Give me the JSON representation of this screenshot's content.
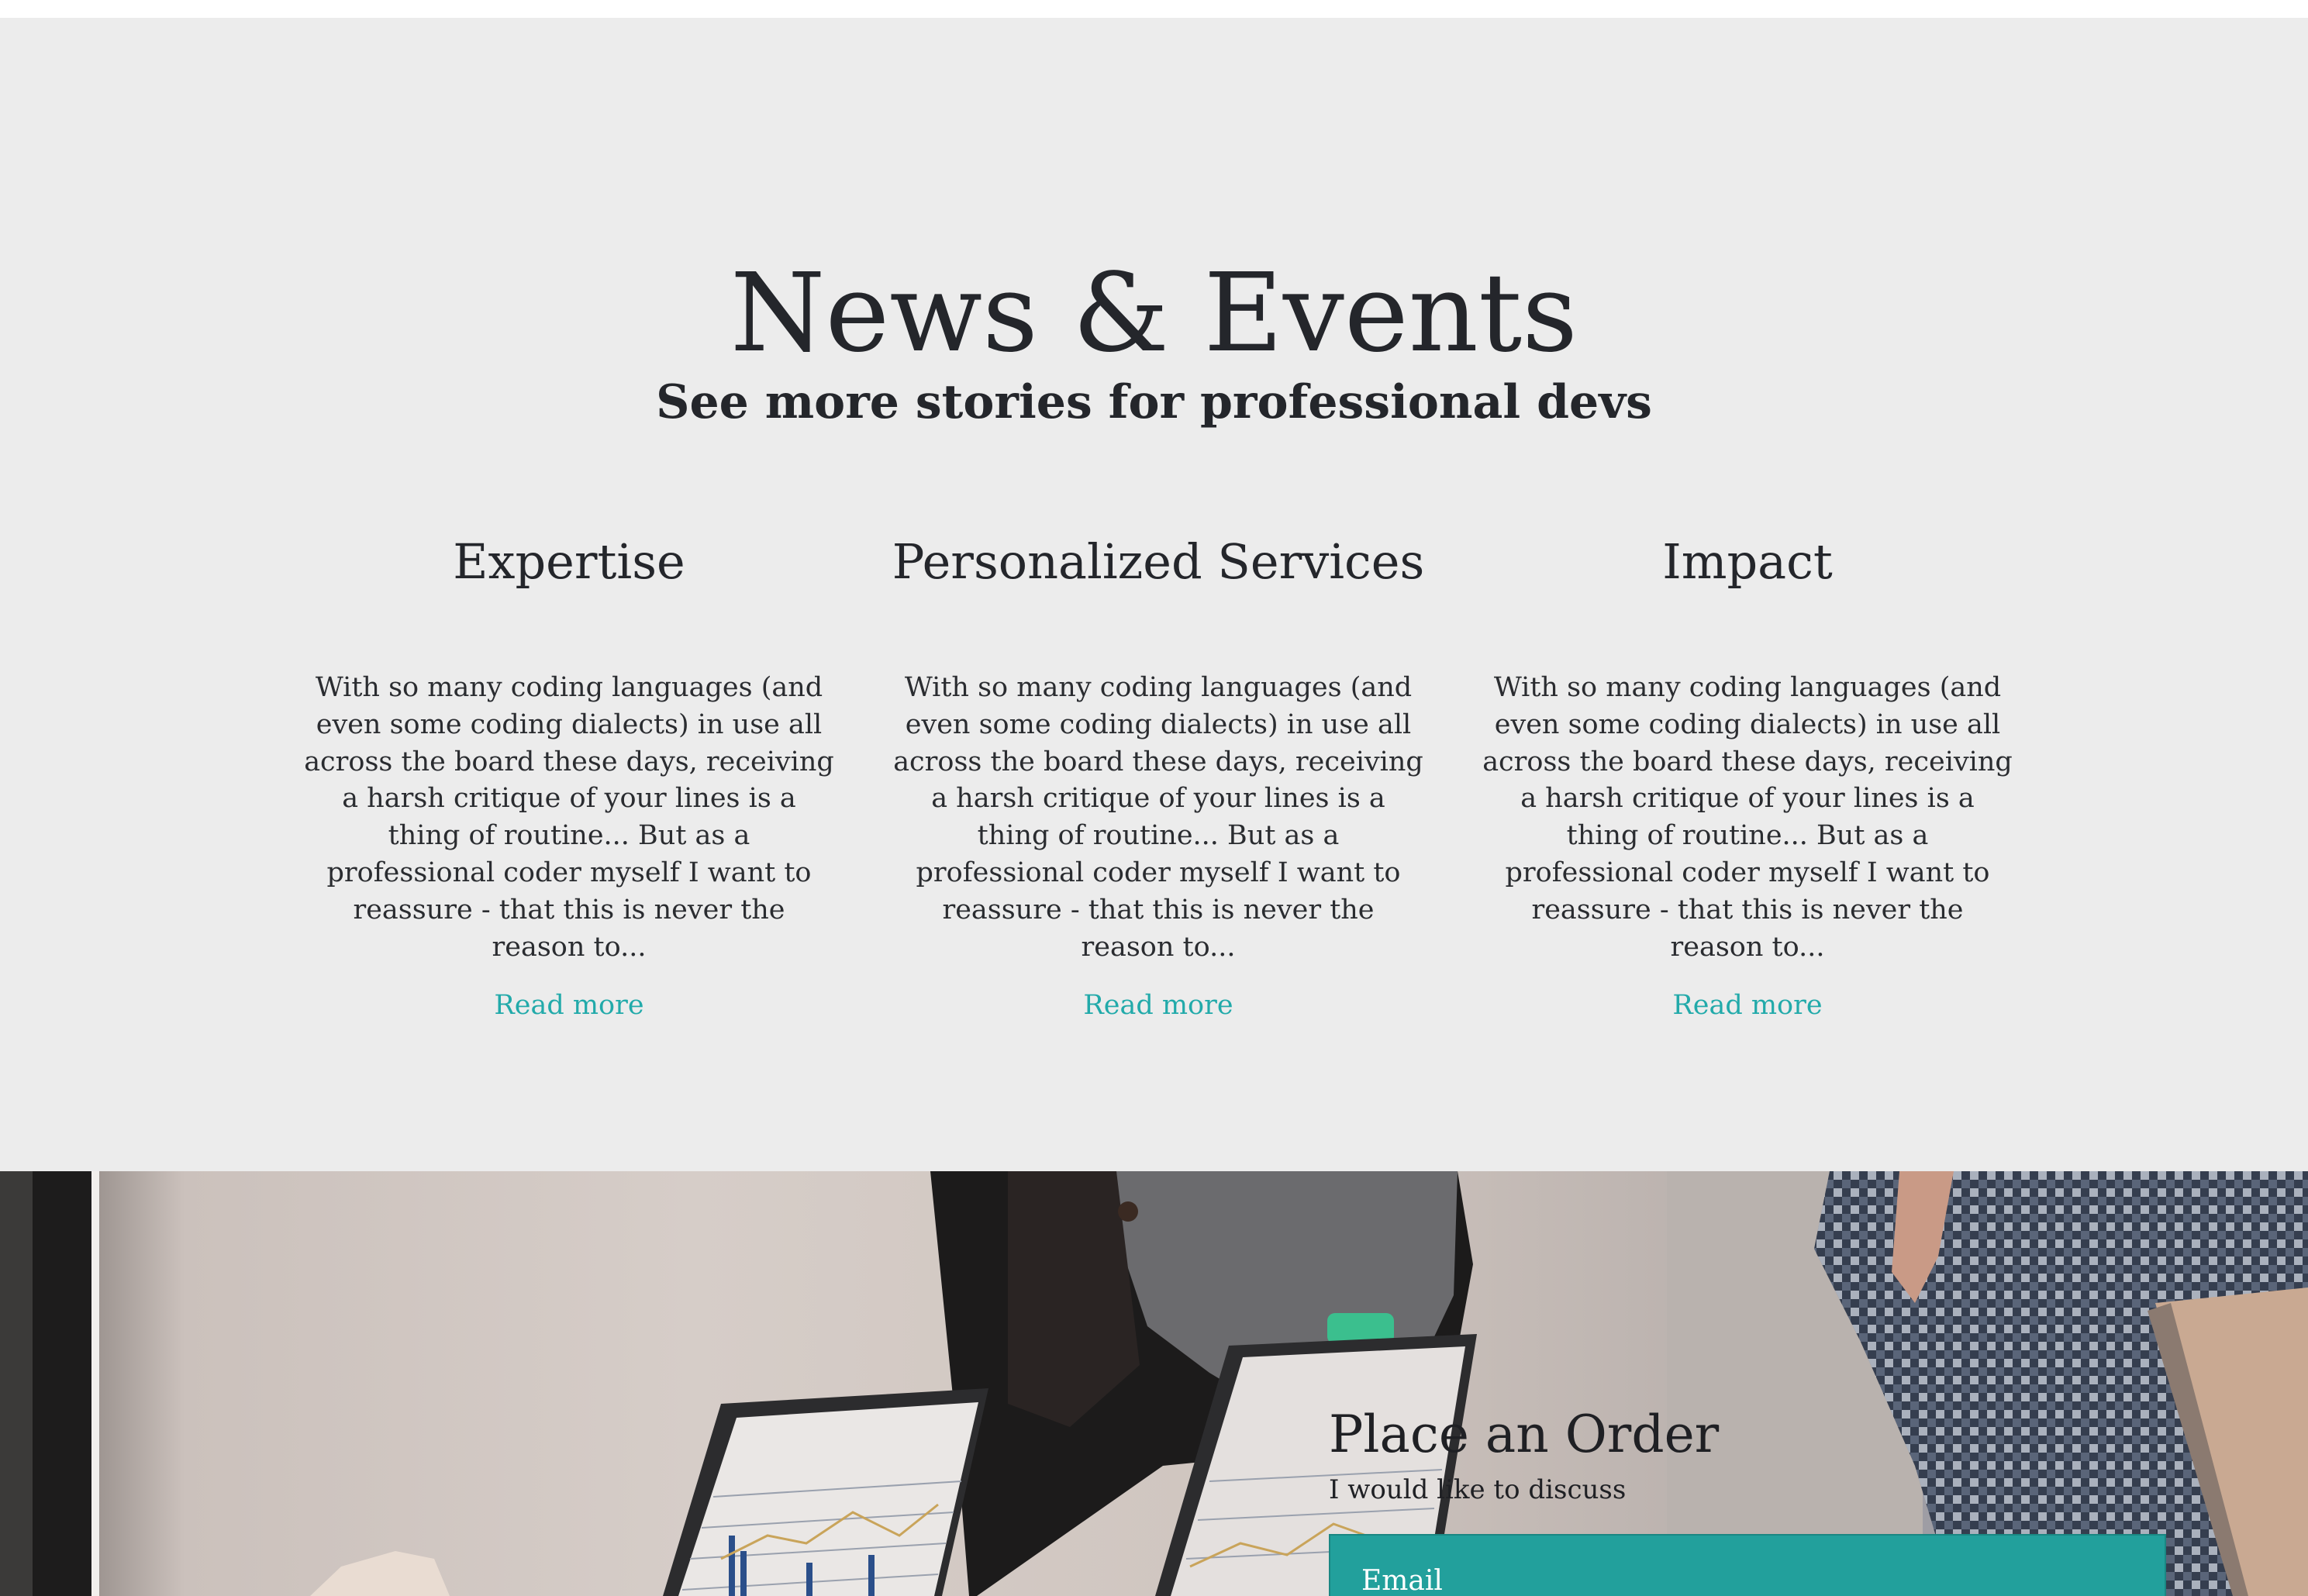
{
  "news": {
    "title": "News & Events",
    "subtitle": "See more stories for professional devs",
    "cards": [
      {
        "title": "Expertise",
        "body": "With so many coding languages (and even some coding dialects) in use all across the board these days, receiving a harsh critique of your lines is a thing of routine... But as a professional coder myself I want to reassure - that this is never the reason to...",
        "link": "Read more"
      },
      {
        "title": "Personalized Services",
        "body": "With so many coding languages (and even some coding dialects) in use all across the board these days, receiving a harsh critique of your lines is a thing of routine... But as a professional coder myself I want to reassure - that this is never the reason to...",
        "link": "Read more"
      },
      {
        "title": "Impact",
        "body": "With so many coding languages (and even some coding dialects) in use all across the board these days, receiving a harsh critique of your lines is a thing of routine... But as a professional coder myself I want to reassure - that this is never the reason to...",
        "link": "Read more"
      }
    ]
  },
  "order": {
    "title": "Place an Order",
    "subtitle": "I would like to discuss",
    "email_placeholder": "Email"
  },
  "colors": {
    "section_background": "#ececec",
    "text": "#24262b",
    "link": "#22aaaa",
    "email_field": "#22a09c"
  }
}
